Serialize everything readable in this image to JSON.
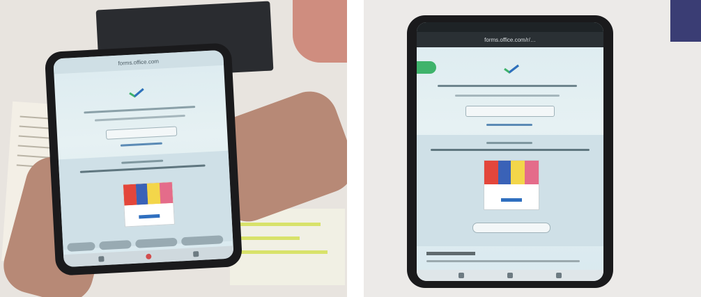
{
  "photos": [
    {
      "side": "left",
      "url_text": "forms.office.com"
    },
    {
      "side": "right",
      "url_text": "forms.office.com/r/…"
    }
  ],
  "colors": {
    "accent_green": "#3fb36b",
    "accent_blue": "#2f6fbf",
    "screen_bg": "#e2eff3",
    "phone_body": "#1a1a1c"
  },
  "icons": [
    "microsoft-forms-checkmark-icon",
    "back-arrow-icon",
    "more-menu-icon",
    "nav-back-icon",
    "nav-home-icon",
    "nav-recents-icon"
  ]
}
